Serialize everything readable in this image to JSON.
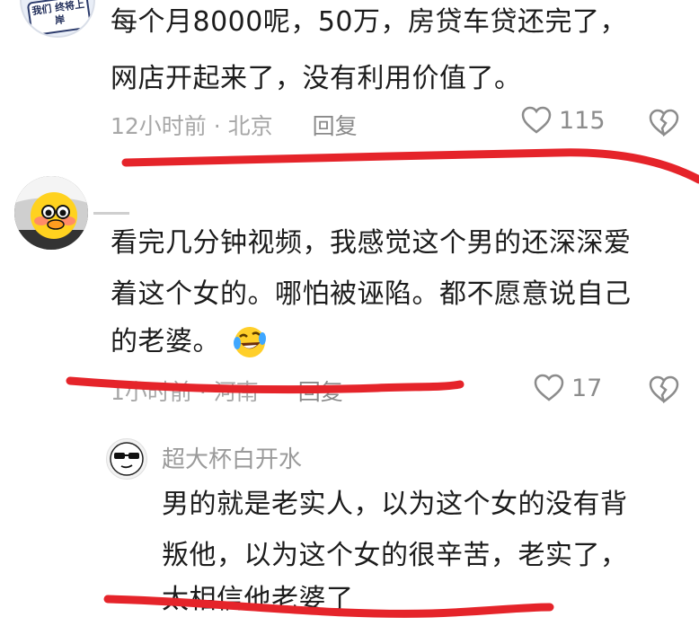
{
  "comment1": {
    "avatar_badge_text": "我们 终将上岸",
    "text_line1": "每个月8000呢，50万，房贷车贷还完了，",
    "text_line2": "网店开起来了，没有利用价值了。",
    "time": "12小时前",
    "location": "北京",
    "reply_label": "回复",
    "likes": "115"
  },
  "comment2": {
    "text_line1": "看完几分钟视频，我感觉这个男的还深深爱",
    "text_line2": "着这个女的。哪怕被诬陷。都不愿意说自己",
    "text_line3": "的老婆。",
    "time": "1小时前",
    "location": "河南",
    "reply_label": "回复",
    "likes": "17"
  },
  "reply1": {
    "username": "超大杯白开水",
    "text_line1": "男的就是老实人，以为这个女的没有背",
    "text_line2": "叛他，以为这个女的很辛苦，老实了，",
    "text_line3": "太相信他老婆了"
  },
  "colors": {
    "annotation_red": "#e5242a",
    "meta_gray": "#a7a7a7"
  }
}
